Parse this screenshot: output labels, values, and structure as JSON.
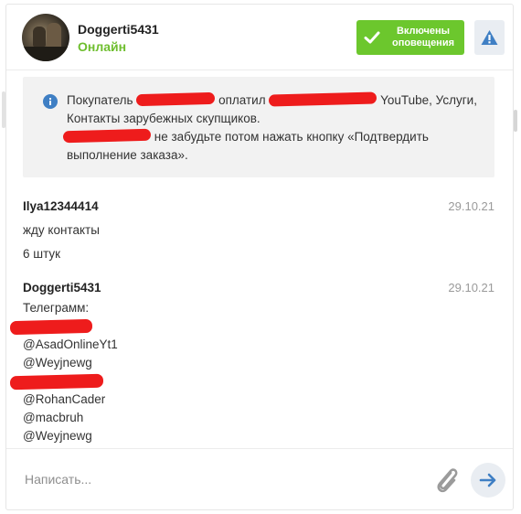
{
  "header": {
    "username": "Doggerti5431",
    "status": "Онлайн",
    "notify_button": "Включены оповещения",
    "warn_icon": "warning-icon"
  },
  "system_notice": {
    "icon": "info-icon",
    "part1": "Покупатель",
    "part2": "оплатил",
    "part3": "YouTube, Услуги, Контакты зарубежных скупщиков.",
    "part4": "не забудьте потом нажать кнопку «Подтвердить выполнение заказа»."
  },
  "messages": [
    {
      "author": "Ilya12344414",
      "date": "29.10.21",
      "lines": [
        "жду контакты",
        "6 штук"
      ]
    },
    {
      "author": "Doggerti5431",
      "date": "29.10.21",
      "lines": [
        "Телеграмм:",
        "@AsadOnlineYt1",
        "@Weyjnewg",
        "@RohanCader",
        "@macbruh",
        "@Weyjnewg"
      ]
    }
  ],
  "composer": {
    "placeholder": "Написать...",
    "attach_icon": "paperclip-icon",
    "send_icon": "arrow-right-icon"
  },
  "colors": {
    "online": "#6ebe2e",
    "notify_bg": "#6cc72d",
    "accent_blue": "#3f7fc4",
    "redaction": "#ee1c1c"
  }
}
